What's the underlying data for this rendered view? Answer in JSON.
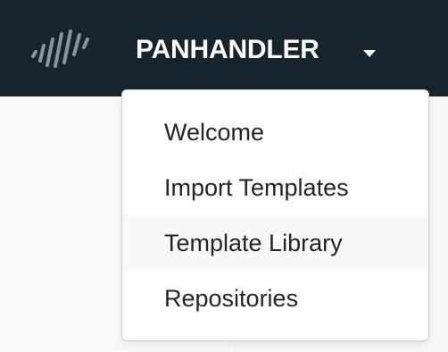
{
  "navbar": {
    "brand": "PANHANDLER",
    "logo_icon": "stylized-bars-logo-icon",
    "caret_icon": "caret-down-icon"
  },
  "dropdown": {
    "items": [
      {
        "label": "Welcome",
        "highlighted": false
      },
      {
        "label": "Import Templates",
        "highlighted": false
      },
      {
        "label": "Template Library",
        "highlighted": true
      },
      {
        "label": "Repositories",
        "highlighted": false
      }
    ]
  },
  "colors": {
    "navbar_background": "#18242d",
    "dropdown_highlight": "#f7f8fa",
    "text": "#212529"
  }
}
